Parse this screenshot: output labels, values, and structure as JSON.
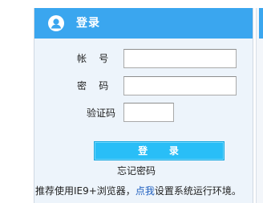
{
  "login": {
    "title": "登录",
    "username_label": "帐    号",
    "username_value": "",
    "password_label": "密    码",
    "password_value": "",
    "captcha_label": "验证码",
    "captcha_value": "",
    "submit_label": "登    录",
    "forgot_password": "忘记密码"
  },
  "tip": {
    "prefix": "推荐使用IE9+浏览器，",
    "link_text": "点我",
    "suffix": "设置系统运行环境。"
  },
  "colors": {
    "header": "#3aa6ef",
    "body_bg": "#edf4fb",
    "button": "#29bef7",
    "link": "#1f5fbf"
  },
  "icons": {
    "header_icon": "user-icon"
  }
}
